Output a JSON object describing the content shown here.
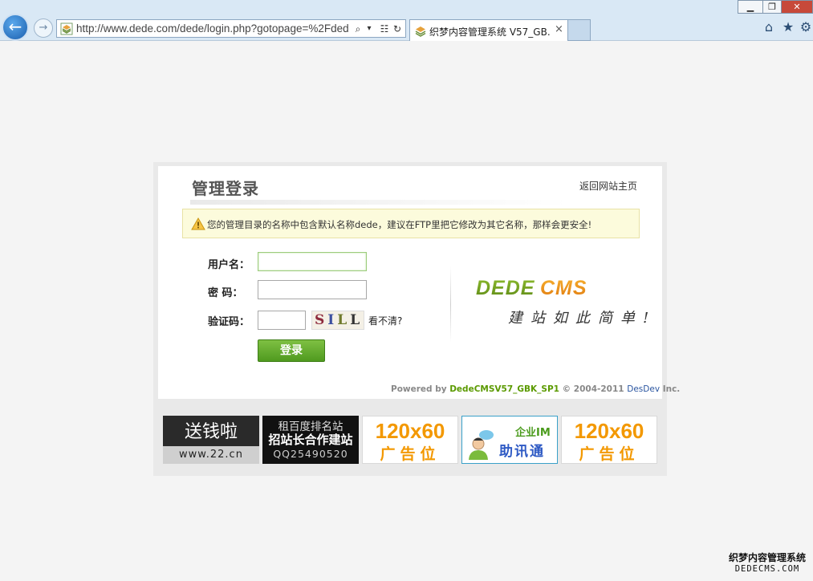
{
  "browser": {
    "url": "http://www.dede.com/dede/login.php?gotopage=%2Fded",
    "tab_title": "织梦内容管理系统 V57_GB...",
    "tab_close": "×",
    "search_glyph": "⌕",
    "dropdown_glyph": "▾",
    "window_controls": {
      "minimize": "▁",
      "restore": "❐",
      "close": "✕"
    },
    "tool_icons": [
      "home-icon",
      "favorites-icon",
      "settings-icon"
    ]
  },
  "login": {
    "title": "管理登录",
    "back_home_link": "返回网站主页",
    "warning": "您的管理目录的名称中包含默认名称dede，建议在FTP里把它修改为其它名称，那样会更安全!",
    "username_label": "用户名：",
    "password_label": "密  码：",
    "captcha_label": "验证码：",
    "username_value": "",
    "password_value": "",
    "captcha_value": "",
    "captcha_chars": [
      "S",
      "I",
      "L",
      "L"
    ],
    "cant_see": "看不清?",
    "submit": "登录",
    "logo_text": "DEDECMS",
    "slogan": "建站如此简单!",
    "powered_prefix": "Powered by",
    "powered_product": "DedeCMSV57_GBK_SP1",
    "powered_copyright": "© 2004-2011",
    "powered_dev": "DesDev",
    "powered_suffix": "Inc.",
    "accent_color": "#5b9a00",
    "warning_bg": "#fcfbdc"
  },
  "ads": [
    {
      "big": "送钱啦",
      "small": "www.22.cn"
    },
    {
      "line1": "租百度排名站",
      "line2": "招站长合作建站",
      "line3": "QQ25490520"
    },
    {
      "num": "120x60",
      "text": "广告位"
    },
    {
      "line1": "企业IM",
      "line2": "助讯通"
    },
    {
      "num": "120x60",
      "text": "广告位"
    }
  ],
  "watermark": {
    "line1": "织梦内容管理系统",
    "line2": "DEDECMS.COM"
  }
}
